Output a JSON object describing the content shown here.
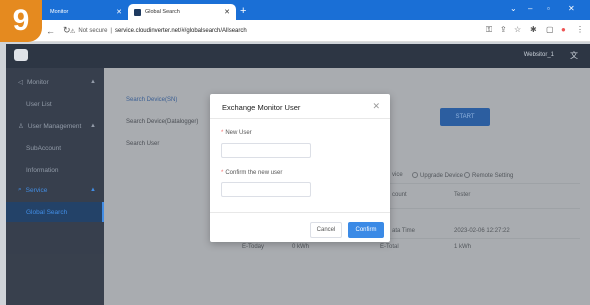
{
  "step_number": "9",
  "browser": {
    "tabs": [
      {
        "label": "Monitor"
      },
      {
        "label": "Global Search"
      }
    ],
    "new_tab": "+",
    "security": "Not secure",
    "separator": "|",
    "url": "service.cloudinverter.net/#/globalsearch/Allsearch"
  },
  "header": {
    "user": "Websitor_1"
  },
  "sidebar": {
    "items": [
      {
        "label": "Monitor"
      },
      {
        "label": "User List"
      },
      {
        "label": "User Management"
      },
      {
        "label": "SubAccount"
      },
      {
        "label": "Information"
      },
      {
        "label": "Service"
      },
      {
        "label": "Global Search"
      }
    ]
  },
  "main": {
    "subtabs": [
      "Search Device(SN)",
      "Search Device(Datalogger)",
      "Search User"
    ],
    "start_button": "START",
    "radio_1": "Upgrade Device",
    "radio_2": "Remote Setting",
    "col_account": "count",
    "col_tester": "Tester",
    "data_time_label": "ata Time",
    "data_time_value": "2023-02-06 12:27:22",
    "etoday_label": "E-Today",
    "etoday_value": "0 kWh",
    "etotal_label": "E-Total",
    "etotal_value": "1 kWh",
    "device_prefix": "vice"
  },
  "modal": {
    "title": "Exchange Monitor User",
    "new_user_label": "New User",
    "new_user_value": "",
    "confirm_label": "Confirm the new user",
    "confirm_value": "",
    "required_mark": "*",
    "cancel": "Cancel",
    "confirm": "Confirm"
  }
}
